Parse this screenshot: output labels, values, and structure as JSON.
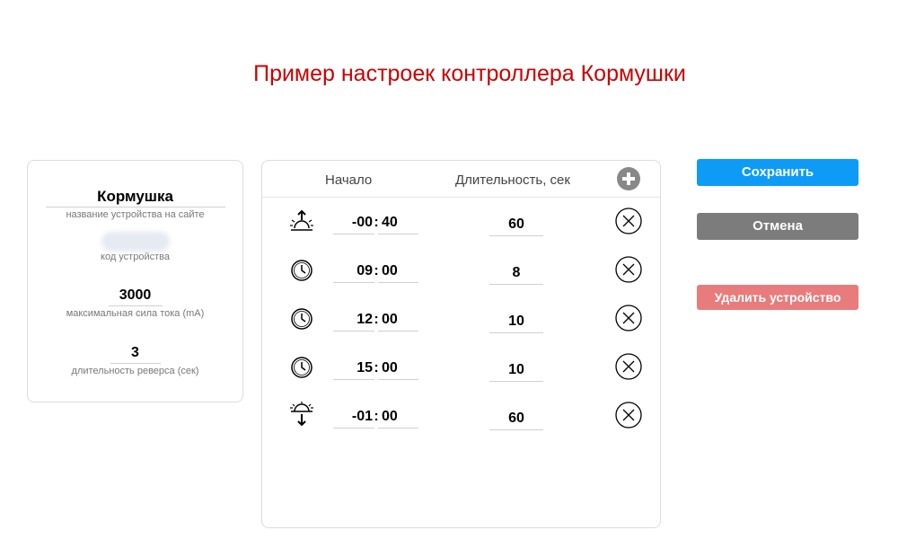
{
  "page": {
    "title": "Пример настроек контроллера Кормушки"
  },
  "device": {
    "name": "Кормушка",
    "name_caption": "название устройства на сайте",
    "code_caption": "код устройства",
    "max_current": "3000",
    "max_current_caption": "максимальная сила тока (mA)",
    "reverse_duration": "3",
    "reverse_duration_caption": "длительность реверса (сек)"
  },
  "schedule": {
    "header_start": "Начало",
    "header_duration": "Длительность, сек",
    "rows": [
      {
        "icon": "sunrise-icon",
        "hours": "-00",
        "minutes": "40",
        "duration": "60"
      },
      {
        "icon": "clock-icon",
        "hours": "09",
        "minutes": "00",
        "duration": "8"
      },
      {
        "icon": "clock-icon",
        "hours": "12",
        "minutes": "00",
        "duration": "10"
      },
      {
        "icon": "clock-icon",
        "hours": "15",
        "minutes": "00",
        "duration": "10"
      },
      {
        "icon": "sunset-icon",
        "hours": "-01",
        "minutes": "00",
        "duration": "60"
      }
    ],
    "separator": ":"
  },
  "actions": {
    "save_label": "Сохранить",
    "cancel_label": "Отмена",
    "delete_device_label": "Удалить устройство"
  },
  "colors": {
    "title": "#cc0000",
    "save": "#0d9bf6",
    "cancel": "#7c7c7c",
    "delete": "#e87c7c"
  }
}
